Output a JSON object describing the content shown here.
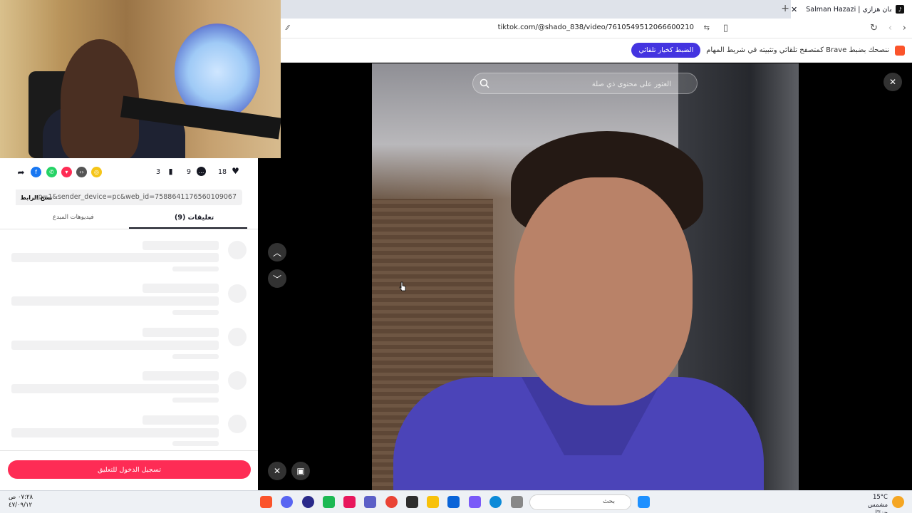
{
  "browser": {
    "tab_title": "Salman Hazazi | سلمان هزازي (@",
    "tab_favicon": "tiktok-icon",
    "url": "tiktok.com/@shado_838/video/7610549512066600210",
    "infobar_message": "ننصحك بضبط Brave كمتصفح تلقائي وتثبيته في شريط المهام",
    "infobar_button": "الضبط كخيار تلقائي"
  },
  "left_panel": {
    "likes": "18",
    "comments": "9",
    "saves": "3",
    "share_icons": [
      "share-arrow-icon",
      "facebook-icon",
      "whatsapp-icon",
      "pinterest-icon",
      "embed-icon",
      "coin-icon"
    ],
    "link_text": "...p=1&sender_device=pc&web_id=7588641176560109067",
    "copy_label": "نسخ الرابط",
    "tab_comments": "(9) تعليقات",
    "tab_creator_videos": "فيديوهات المبدع",
    "login_button": "تسجيل الدخول للتعليق"
  },
  "video": {
    "search_placeholder": "العثور على محتوى ذي صلة"
  },
  "taskbar": {
    "time": "٠٧:٢٨ ص",
    "date": "٤٧/٠٩/١٢",
    "search_placeholder": "بحث",
    "weather_temp": "15°C",
    "weather_desc": "مشمس جزئيًا"
  },
  "colors": {
    "tiktok_red": "#fe2c55",
    "brave_button": "#4434e0",
    "facebook": "#1877f2",
    "whatsapp": "#25d366",
    "pinterest": "#fe2c55",
    "coin": "#f5c518"
  }
}
